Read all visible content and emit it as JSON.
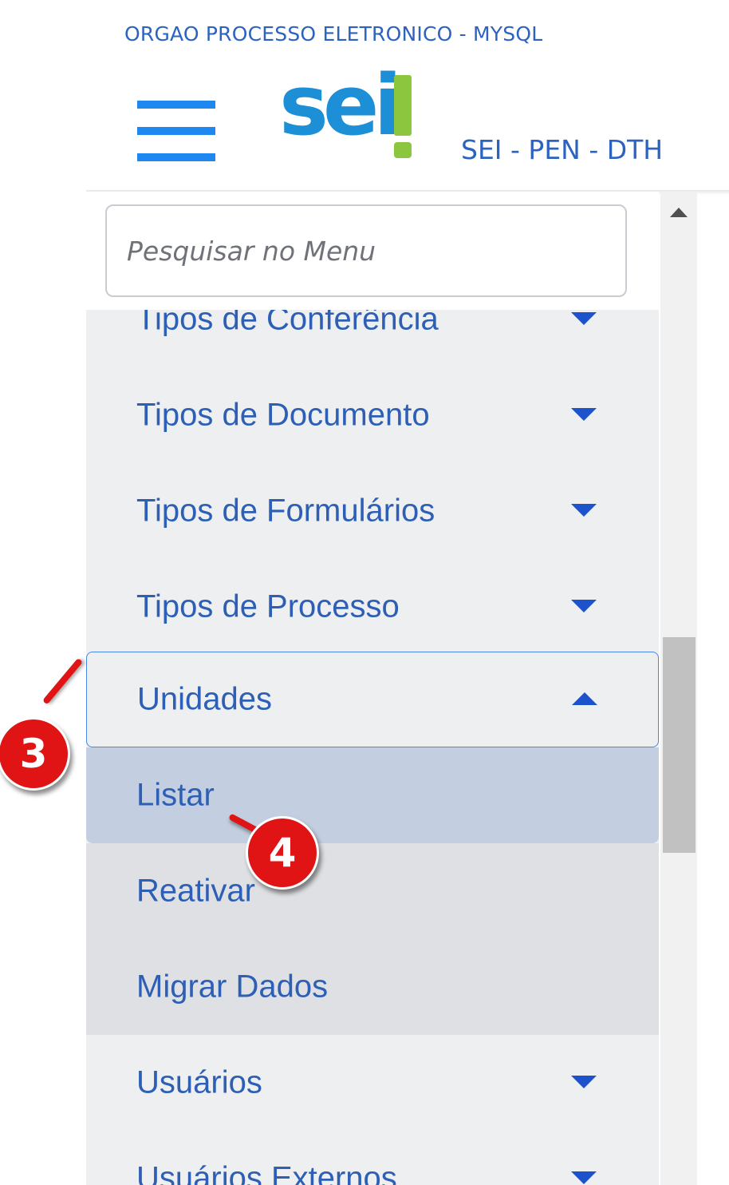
{
  "header": {
    "org_name": "ORGAO PROCESSO ELETRONICO - MYSQL",
    "logo_text": "sei",
    "system_name": "SEI - PEN - DTH"
  },
  "search": {
    "placeholder": "Pesquisar no Menu",
    "value": ""
  },
  "menu": {
    "items": [
      {
        "label": "Tipos de Conferência",
        "icon": "caret-down-icon"
      },
      {
        "label": "Tipos de Documento",
        "icon": "caret-down-icon"
      },
      {
        "label": "Tipos de Formulários",
        "icon": "caret-down-icon"
      },
      {
        "label": "Tipos de Processo",
        "icon": "caret-down-icon"
      },
      {
        "label": "Unidades",
        "icon": "caret-up-icon",
        "expanded": true
      },
      {
        "label": "Usuários",
        "icon": "caret-down-icon"
      },
      {
        "label": "Usuários Externos",
        "icon": "caret-down-icon"
      }
    ],
    "unidades_submenu": [
      {
        "label": "Listar",
        "selected": true
      },
      {
        "label": "Reativar"
      },
      {
        "label": "Migrar Dados"
      }
    ]
  },
  "callouts": {
    "step_3": "3",
    "step_4": "4"
  },
  "colors": {
    "accent_blue": "#1e88f0",
    "menu_text": "#2c5fb5",
    "logo_green": "#8cc63f",
    "callout_red": "#e01414"
  }
}
